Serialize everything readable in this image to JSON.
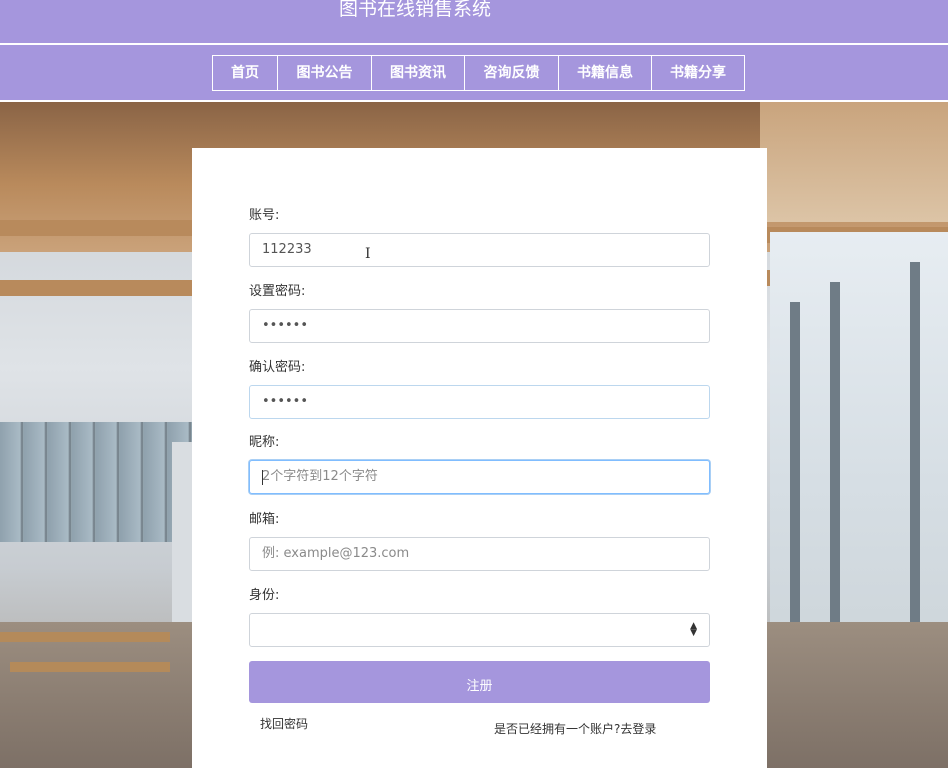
{
  "header": {
    "title": "图书在线销售系统"
  },
  "nav": {
    "items": [
      {
        "label": "首页",
        "name": "nav-home"
      },
      {
        "label": "图书公告",
        "name": "nav-announcements"
      },
      {
        "label": "图书资讯",
        "name": "nav-news"
      },
      {
        "label": "咨询反馈",
        "name": "nav-feedback"
      },
      {
        "label": "书籍信息",
        "name": "nav-book-info"
      },
      {
        "label": "书籍分享",
        "name": "nav-book-share"
      }
    ]
  },
  "form": {
    "account": {
      "label": "账号:",
      "value": "112233"
    },
    "password": {
      "label": "设置密码:",
      "value": "••••••"
    },
    "confirm_password": {
      "label": "确认密码:",
      "value": "••••••"
    },
    "nickname": {
      "label": "昵称:",
      "placeholder": "2个字符到12个字符"
    },
    "email": {
      "label": "邮箱:",
      "placeholder": "例: example@123.com"
    },
    "role": {
      "label": "身份:",
      "value": ""
    },
    "register_label": "注册",
    "recover_label": "找回密码",
    "login_prompt": "是否已经拥有一个账户?去登录"
  },
  "colors": {
    "accent": "#a596dd",
    "focus": "#80bdff"
  },
  "icons": {
    "select": "chevron-updown-icon",
    "cursor": "text-cursor-icon"
  }
}
